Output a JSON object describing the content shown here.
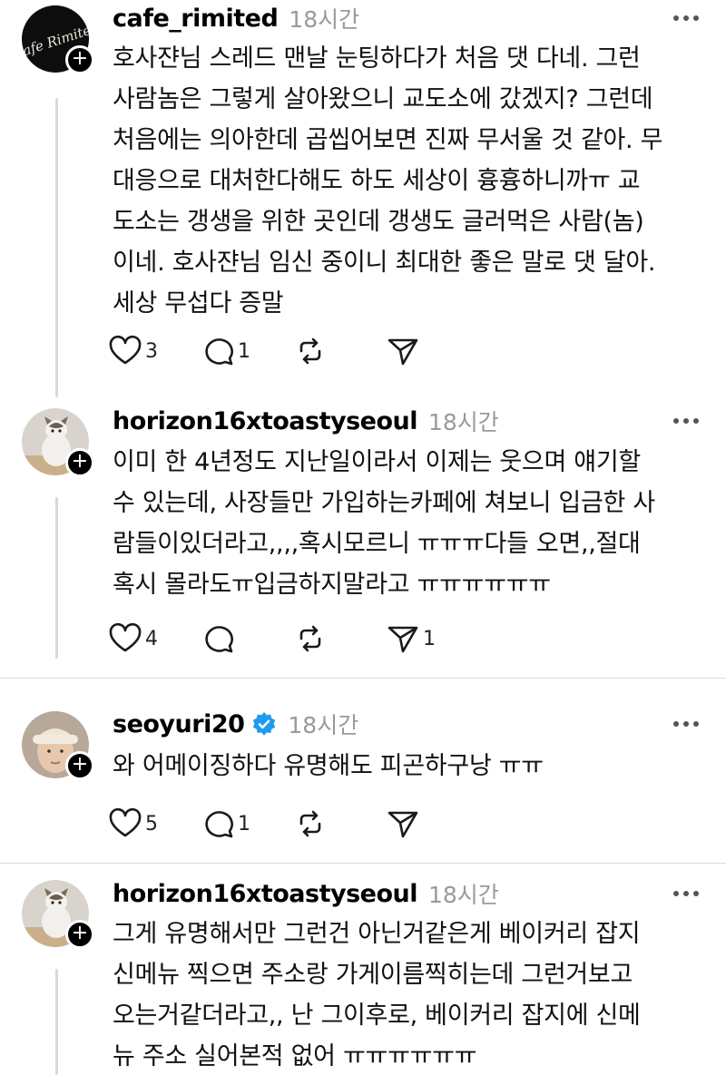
{
  "posts": [
    {
      "username": "cafe_rimited",
      "time": "18시간",
      "verified": false,
      "avatar_logo_text": "Cafe Rimited",
      "text": "호사쟌님 스레드 맨날 눈팅하다가 처음 댓 다네. 그런\n사람놈은 그렇게 살아왔으니 교도소에 갔겠지? 그런데\n처음에는 의아한데 곱씹어보면 진짜 무서울 것 같아. 무\n대응으로 대처한다해도 하도 세상이 흉흉하니까ㅠ 교\n도소는 갱생을 위한 곳인데 갱생도 글러먹은 사람(놈)\n이네. 호사쟌님 임신 중이니 최대한 좋은 말로 댓 달아.\n세상 무섭다 증말",
      "likes": "3",
      "replies": "1",
      "reposts": "",
      "shares": ""
    },
    {
      "username": "horizon16xtoastyseoul",
      "time": "18시간",
      "verified": false,
      "text": "이미 한 4년정도 지난일이라서 이제는 웃으며 얘기할\n수 있는데, 사장들만 가입하는카페에 쳐보니 입금한 사\n람들이있더라고,,,,혹시모르니 ㅠㅠㅠ다들 오면,,절대\n혹시 몰라도ㅠ입금하지말라고 ㅠㅠㅠㅠㅠㅠ",
      "likes": "4",
      "replies": "",
      "reposts": "",
      "shares": "1"
    },
    {
      "username": "seoyuri20",
      "time": "18시간",
      "verified": true,
      "text": "와 어메이징하다 유명해도 피곤하구낭 ㅠㅠ",
      "likes": "5",
      "replies": "1",
      "reposts": "",
      "shares": ""
    },
    {
      "username": "horizon16xtoastyseoul",
      "time": "18시간",
      "verified": false,
      "text": "그게 유명해서만 그런건 아닌거같은게 베이커리 잡지\n신메뉴 찍으면 주소랑 가게이름찍히는데 그런거보고\n오는거같더라고,, 난 그이후로,  베이커리 잡지에 신메\n뉴 주소 실어본적 없어 ㅠㅠㅠㅠㅠㅠ",
      "likes": "",
      "replies": "",
      "reposts": "",
      "shares": ""
    }
  ],
  "icons": {
    "like": "heart-icon",
    "reply": "comment-icon",
    "repost": "repost-icon",
    "share": "send-icon",
    "more": "more-icon",
    "follow": "plus-icon",
    "verified": "verified-badge-icon"
  },
  "colors": {
    "verified_blue": "#1d9bf0",
    "timestamp_gray": "#9a9a9a",
    "thread_line": "#d9d9d9"
  }
}
